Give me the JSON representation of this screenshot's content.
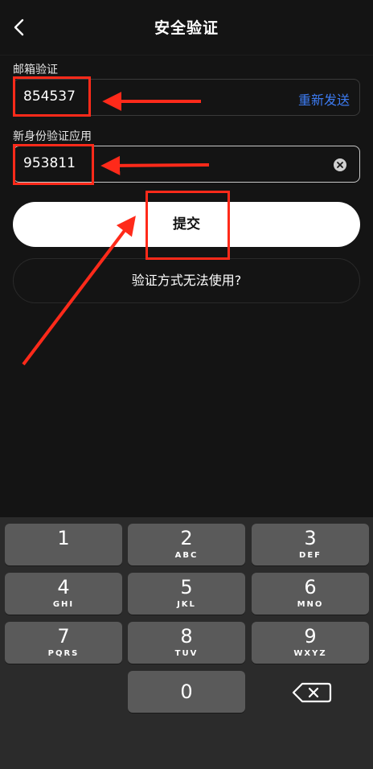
{
  "header": {
    "title": "安全验证"
  },
  "email": {
    "label": "邮箱验证",
    "value": "854537",
    "resend": "重新发送"
  },
  "authenticator": {
    "label": "新身份验证应用",
    "value": "953811"
  },
  "actions": {
    "submit": "提交",
    "alternative": "验证方式无法使用?"
  },
  "keyboard": {
    "keys": [
      {
        "num": "1",
        "letters": ""
      },
      {
        "num": "2",
        "letters": "ABC"
      },
      {
        "num": "3",
        "letters": "DEF"
      },
      {
        "num": "4",
        "letters": "GHI"
      },
      {
        "num": "5",
        "letters": "JKL"
      },
      {
        "num": "6",
        "letters": "MNO"
      },
      {
        "num": "7",
        "letters": "PQRS"
      },
      {
        "num": "8",
        "letters": "TUV"
      },
      {
        "num": "9",
        "letters": "WXYZ"
      },
      {
        "num": "0",
        "letters": ""
      }
    ]
  },
  "colors": {
    "accent": "#3d7bf2",
    "annotation": "#ff2a1a",
    "background": "#141414"
  }
}
